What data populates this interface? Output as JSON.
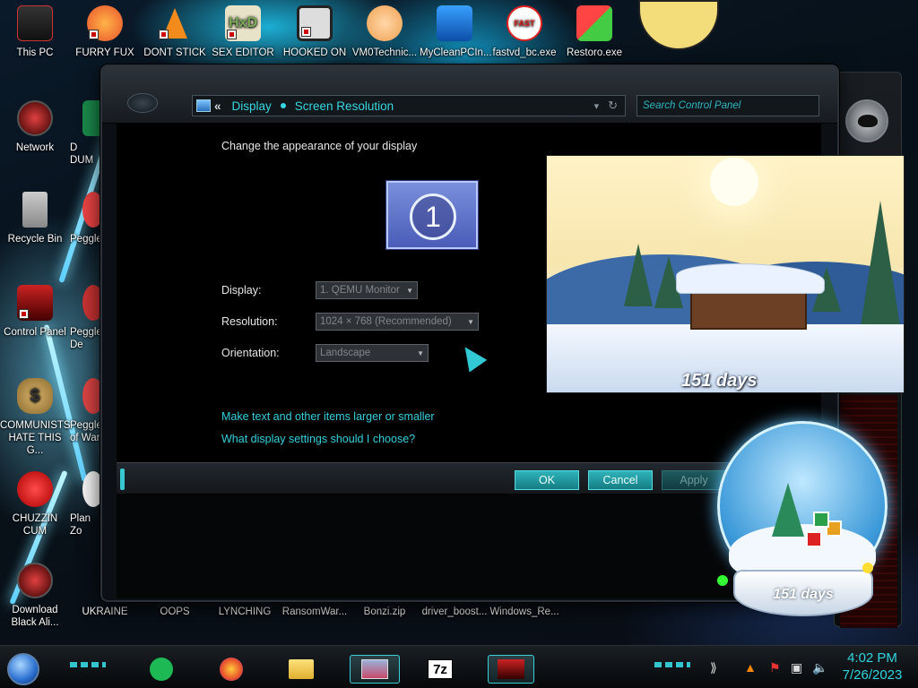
{
  "desktop": {
    "icons_top": [
      {
        "label": "This PC"
      },
      {
        "label": "FURRY FUX"
      },
      {
        "label": "DONT STICK"
      },
      {
        "label": "SEX EDITOR"
      },
      {
        "label": "HOOKED ON"
      },
      {
        "label": "VM0Technic..."
      },
      {
        "label": "MyCleanPCIn..."
      },
      {
        "label": "fastvd_bc.exe"
      },
      {
        "label": "Restoro.exe"
      }
    ],
    "icons_left": [
      {
        "label": "Network"
      },
      {
        "label": "Recycle Bin"
      },
      {
        "label": "Control Panel"
      },
      {
        "label": "COMMUNISTS HATE THIS G..."
      },
      {
        "label": "CHUZZIN CUM"
      },
      {
        "label": "Download Black Ali..."
      }
    ],
    "icons_left2": [
      {
        "label": "D DUM"
      },
      {
        "label": "Peggle"
      },
      {
        "label": "Peggle De"
      },
      {
        "label": "Peggle of War"
      },
      {
        "label": "Plan Zo"
      },
      {
        "label": "UKRAINE"
      }
    ],
    "icons_bottom": [
      {
        "label": "OOPS"
      },
      {
        "label": "LYNCHING"
      },
      {
        "label": "RansomWar..."
      },
      {
        "label": "Bonzi.zip"
      },
      {
        "label": "driver_boost..."
      },
      {
        "label": "Windows_Re..."
      }
    ]
  },
  "window": {
    "address": {
      "chevron": "«",
      "crumb1": "Display",
      "crumb2": "Screen Resolution"
    },
    "search_placeholder": "Search Control Panel",
    "heading": "Change the appearance of your display",
    "monitor_number": "1",
    "display_label": "Display:",
    "display_value": "1. QEMU Monitor",
    "resolution_label": "Resolution:",
    "resolution_value": "1024 × 768 (Recommended)",
    "orientation_label": "Orientation:",
    "orientation_value": "Landscape",
    "link1": "Make text and other items larger or smaller",
    "link2": "What display settings should I choose?",
    "ok": "OK",
    "cancel": "Cancel",
    "apply": "Apply"
  },
  "gadgets": {
    "photo_caption": "151 days",
    "globe_caption": "151 days"
  },
  "taskbar": {
    "time": "4:02 PM",
    "date": "7/26/2023",
    "apps": [
      "spotify-icon",
      "firefox-icon",
      "explorer-icon",
      "display-settings-icon",
      "7zip-icon",
      "alienware-icon"
    ],
    "sevenzip_text": "7z"
  },
  "colors": {
    "accent": "#35d0dc",
    "window_bg": "#000000"
  }
}
